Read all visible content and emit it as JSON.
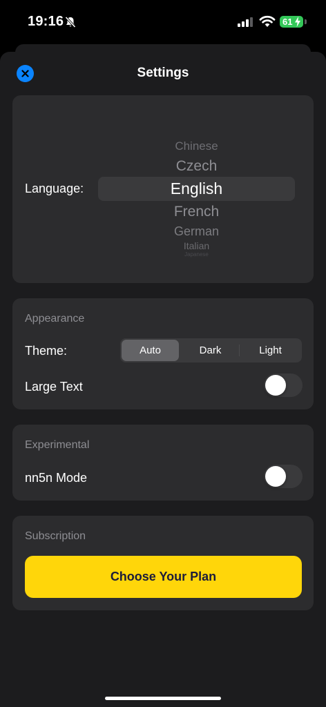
{
  "status_bar": {
    "time": "19:16",
    "battery_level": "61",
    "icons": [
      "bell-slash-icon",
      "cellular-signal-icon",
      "wifi-icon",
      "battery-charging-icon"
    ]
  },
  "sheet": {
    "title": "Settings",
    "close_icon": "close-icon",
    "accent_color": "#0a84ff"
  },
  "language": {
    "label": "Language:",
    "options": [
      "Chinese",
      "Czech",
      "English",
      "French",
      "German",
      "Italian",
      "Japanese"
    ],
    "selected": "English"
  },
  "appearance": {
    "header": "Appearance",
    "theme_label": "Theme:",
    "theme_options": [
      "Auto",
      "Dark",
      "Light"
    ],
    "theme_selected": "Auto",
    "large_text_label": "Large Text",
    "large_text_on": false
  },
  "experimental": {
    "header": "Experimental",
    "nn5n_label": "nn5n Mode",
    "nn5n_on": false
  },
  "subscription": {
    "header": "Subscription",
    "button_label": "Choose Your Plan",
    "button_color": "#ffd60a"
  }
}
